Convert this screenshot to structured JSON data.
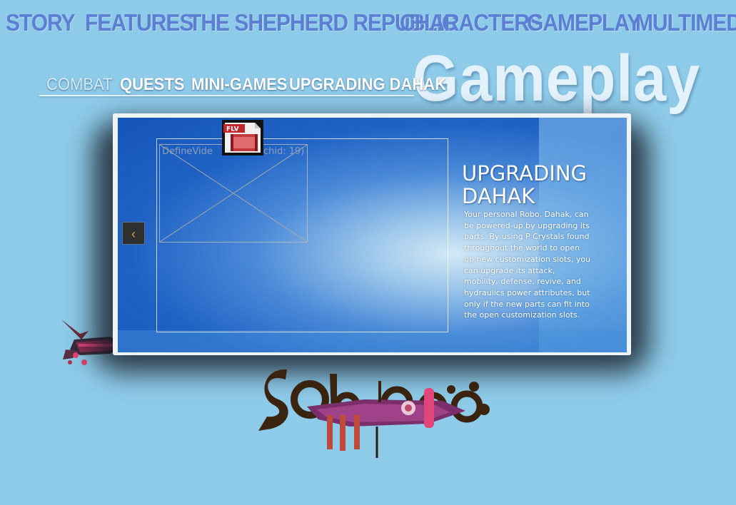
{
  "nav": {
    "items": [
      {
        "label": "STORY",
        "key": "story"
      },
      {
        "label": "FEATURES",
        "key": "features"
      },
      {
        "label": "THE SHEPHERD REPUBLIC",
        "key": "shepherd-republic"
      },
      {
        "label": "CHARACTERS",
        "key": "characters"
      },
      {
        "label": "GAMEPLAY",
        "key": "gameplay"
      },
      {
        "label": "MULTIMEDIA",
        "key": "multimedia"
      }
    ]
  },
  "section_title": "Gameplay",
  "subnav": {
    "items": [
      {
        "label": "COMBAT",
        "key": "combat",
        "active": true
      },
      {
        "label": "QUESTS",
        "key": "quests"
      },
      {
        "label": "MINI-GAMES",
        "key": "mini-games"
      },
      {
        "label": "UPGRADING  DAHAK",
        "key": "upgrading-dahak"
      }
    ]
  },
  "video": {
    "placeholder_label": "DefineVide",
    "placeholder_suffix": "(chid: 19)",
    "flv_label": "FLV"
  },
  "info": {
    "title_line1": "UPGRADING",
    "title_line2": "DAHAK",
    "body": "Your personal Robo, Dahak, can be powered-up by upgrading its parts. By using P Crystals found throughout the world to open up new customization slots, you can upgrade its attack, mobility, defense, revive, and hydraulics power attributes, but only if the new parts can fit into the open customization slots."
  },
  "controls": {
    "prev_arrow": "‹"
  },
  "colors": {
    "background": "#8dcbe9",
    "nav_text": "#5c7fd3",
    "panel_blue": "#1f62c4",
    "accent_gold": "#d6a84a"
  }
}
